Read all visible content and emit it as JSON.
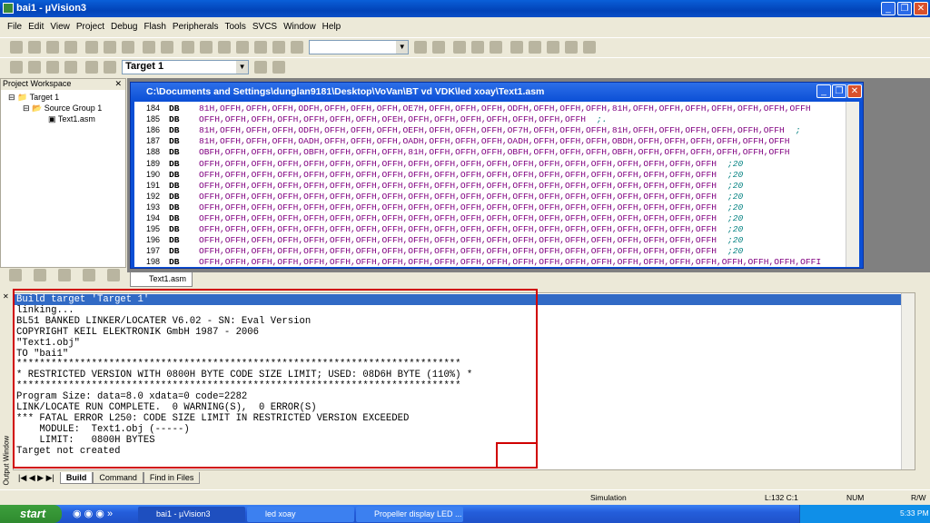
{
  "window": {
    "title": "bai1  - µVision3"
  },
  "menu": [
    "File",
    "Edit",
    "View",
    "Project",
    "Debug",
    "Flash",
    "Peripherals",
    "Tools",
    "SVCS",
    "Window",
    "Help"
  ],
  "toolbar": {
    "find_value": "",
    "target_select": "Target 1"
  },
  "workspace": {
    "title": "Project Workspace",
    "tree": [
      "Target 1",
      "Source Group 1",
      "Text1.asm"
    ]
  },
  "editor": {
    "title": "C:\\Documents and Settings\\dunglan9181\\Desktop\\VoVan\\BT vd VDK\\led xoay\\Text1.asm",
    "tab": "Text1.asm",
    "lines": [
      {
        "n": "184",
        "kw": "DB",
        "v": "81H,OFFH,OFFH,OFFH,ODFH,OFFH,OFFH,OFFH,OE7H,OFFH,OFFH,OFFH,ODFH,OFFH,OFFH,OFFH,81H,OFFH,OFFH,OFFH,OFFH,OFFH,OFFH,OFFH",
        "c": ""
      },
      {
        "n": "185",
        "kw": "DB",
        "v": "OFFH,OFFH,OFFH,OFFH,OFFH,OFFH,OFFH,OFEH,OFFH,OFFH,OFFH,OFFH,OFFH,OFFH,OFFH",
        "c": ";."
      },
      {
        "n": "186",
        "kw": "DB",
        "v": "81H,OFFH,OFFH,OFFH,ODFH,OFFH,OFFH,OFFH,OEFH,OFFH,OFFH,OFFH,OF7H,OFFH,OFFH,OFFH,81H,OFFH,OFFH,OFFH,OFFH,OFFH,OFFH",
        "c": ";"
      },
      {
        "n": "187",
        "kw": "DB",
        "v": "81H,OFFH,OFFH,OFFH,OADH,OFFH,OFFH,OFFH,OADH,OFFH,OFFH,OFFH,OADH,OFFH,OFFH,OFFH,OBDH,OFFH,OFFH,OFFH,OFFH,OFFH,OFFH",
        "c": ""
      },
      {
        "n": "188",
        "kw": "DB",
        "v": "OBFH,OFFH,OFFH,OFFH,OBFH,OFFH,OFFH,OFFH,81H,OFFH,OFFH,OFFH,OBFH,OFFH,OFFH,OFFH,OBFH,OFFH,OFFH,OFFH,OFFH,OFFH,OFFH",
        "c": ""
      },
      {
        "n": "189",
        "kw": "DB",
        "v": "OFFH,OFFH,OFFH,OFFH,OFFH,OFFH,OFFH,OFFH,OFFH,OFFH,OFFH,OFFH,OFFH,OFFH,OFFH,OFFH,OFFH,OFFH,OFFH,OFFH",
        "c": ";20"
      },
      {
        "n": "190",
        "kw": "DB",
        "v": "OFFH,OFFH,OFFH,OFFH,OFFH,OFFH,OFFH,OFFH,OFFH,OFFH,OFFH,OFFH,OFFH,OFFH,OFFH,OFFH,OFFH,OFFH,OFFH,OFFH",
        "c": ";20"
      },
      {
        "n": "191",
        "kw": "DB",
        "v": "OFFH,OFFH,OFFH,OFFH,OFFH,OFFH,OFFH,OFFH,OFFH,OFFH,OFFH,OFFH,OFFH,OFFH,OFFH,OFFH,OFFH,OFFH,OFFH,OFFH",
        "c": ";20"
      },
      {
        "n": "192",
        "kw": "DB",
        "v": "OFFH,OFFH,OFFH,OFFH,OFFH,OFFH,OFFH,OFFH,OFFH,OFFH,OFFH,OFFH,OFFH,OFFH,OFFH,OFFH,OFFH,OFFH,OFFH,OFFH",
        "c": ";20"
      },
      {
        "n": "193",
        "kw": "DB",
        "v": "OFFH,OFFH,OFFH,OFFH,OFFH,OFFH,OFFH,OFFH,OFFH,OFFH,OFFH,OFFH,OFFH,OFFH,OFFH,OFFH,OFFH,OFFH,OFFH,OFFH",
        "c": ";20"
      },
      {
        "n": "194",
        "kw": "DB",
        "v": "OFFH,OFFH,OFFH,OFFH,OFFH,OFFH,OFFH,OFFH,OFFH,OFFH,OFFH,OFFH,OFFH,OFFH,OFFH,OFFH,OFFH,OFFH,OFFH,OFFH",
        "c": ";20"
      },
      {
        "n": "195",
        "kw": "DB",
        "v": "OFFH,OFFH,OFFH,OFFH,OFFH,OFFH,OFFH,OFFH,OFFH,OFFH,OFFH,OFFH,OFFH,OFFH,OFFH,OFFH,OFFH,OFFH,OFFH,OFFH",
        "c": ";20"
      },
      {
        "n": "196",
        "kw": "DB",
        "v": "OFFH,OFFH,OFFH,OFFH,OFFH,OFFH,OFFH,OFFH,OFFH,OFFH,OFFH,OFFH,OFFH,OFFH,OFFH,OFFH,OFFH,OFFH,OFFH,OFFH",
        "c": ";20"
      },
      {
        "n": "197",
        "kw": "DB",
        "v": "OFFH,OFFH,OFFH,OFFH,OFFH,OFFH,OFFH,OFFH,OFFH,OFFH,OFFH,OFFH,OFFH,OFFH,OFFH,OFFH,OFFH,OFFH,OFFH,OFFH",
        "c": ";20"
      },
      {
        "n": "198",
        "kw": "DB",
        "v": "OFFH,OFFH,OFFH,OFFH,OFFH,OFFH,OFFH,OFFH,OFFH,OFFH,OFFH,OFFH,OFFH,OFFH,OFFH,OFFH,OFFH,OFFH,OFFH,OFFH,OFFH,OFFH,OFFH,OFFI",
        "c": ""
      }
    ]
  },
  "output": {
    "side_label": "Output Window",
    "lines": [
      "Build target 'Target 1'",
      "linking...",
      "BL51 BANKED LINKER/LOCATER V6.02 - SN: Eval Version",
      "COPYRIGHT KEIL ELEKTRONIK GmbH 1987 - 2006",
      "\"Text1.obj\"",
      "TO \"bai1\"",
      "*****************************************************************************",
      "* RESTRICTED VERSION WITH 0800H BYTE CODE SIZE LIMIT; USED: 08D6H BYTE (110%) *",
      "*****************************************************************************",
      "Program Size: data=8.0 xdata=0 code=2282",
      "LINK/LOCATE RUN COMPLETE.  0 WARNING(S),  0 ERROR(S)",
      "*** FATAL ERROR L250: CODE SIZE LIMIT IN RESTRICTED VERSION EXCEEDED",
      "    MODULE:  Text1.obj (-----)",
      "    LIMIT:   0800H BYTES",
      "Target not created"
    ],
    "tabs": [
      "Build",
      "Command",
      "Find in Files"
    ]
  },
  "status": {
    "mode": "Simulation",
    "position": "L:132 C:1",
    "num": "NUM",
    "rw": "R/W"
  },
  "taskbar": {
    "start": "start",
    "tasks": [
      "bai1 - µVision3",
      "led xoay",
      "Propeller display LED ..."
    ],
    "clock": "5:33 PM"
  }
}
